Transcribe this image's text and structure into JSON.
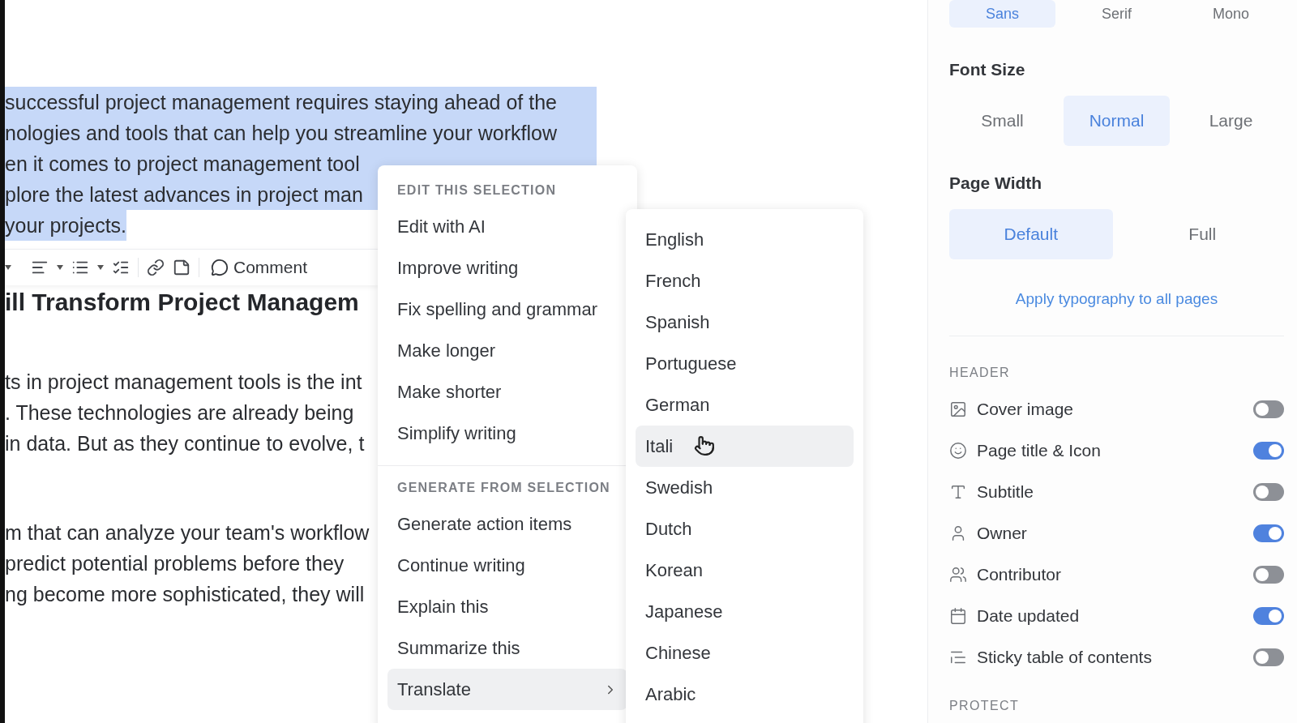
{
  "editor": {
    "selection": {
      "selected": true,
      "lines": [
        "successful project management requires staying ahead of the",
        "nologies and tools that can help you streamline your workflow",
        "en it comes to project management tool",
        "plore the latest advances in project man",
        "your projects."
      ]
    },
    "toolbar": {
      "comment_label": "Comment"
    },
    "heading": "ill Transform Project Managem",
    "paragraphs": [
      [
        "ts in project management tools is the int",
        ". These technologies are already being",
        "in data. But as they continue to evolve, t"
      ],
      [
        "m that can analyze your team's workflow",
        "predict potential problems before they",
        "ng become more sophisticated, they will"
      ]
    ]
  },
  "menu": {
    "sections": [
      {
        "title": "EDIT THIS SELECTION",
        "items": [
          {
            "label": "Edit with AI",
            "selected": false
          },
          {
            "label": "Improve writing",
            "selected": false
          },
          {
            "label": "Fix spelling and grammar",
            "selected": false
          },
          {
            "label": "Make longer",
            "selected": false
          },
          {
            "label": "Make shorter",
            "selected": false
          },
          {
            "label": "Simplify writing",
            "selected": false
          }
        ]
      },
      {
        "title": "GENERATE FROM SELECTION",
        "items": [
          {
            "label": "Generate action items",
            "selected": false
          },
          {
            "label": "Continue writing",
            "selected": false
          },
          {
            "label": "Explain this",
            "selected": false
          },
          {
            "label": "Summarize this",
            "selected": false
          },
          {
            "label": "Translate",
            "selected": true,
            "submenu": true
          }
        ]
      }
    ]
  },
  "submenu": {
    "items": [
      {
        "label": "English",
        "selected": false
      },
      {
        "label": "French",
        "selected": false
      },
      {
        "label": "Spanish",
        "selected": false
      },
      {
        "label": "Portuguese",
        "selected": false
      },
      {
        "label": "German",
        "selected": false
      },
      {
        "label": "Itali",
        "selected": true
      },
      {
        "label": "Swedish",
        "selected": false
      },
      {
        "label": "Dutch",
        "selected": false
      },
      {
        "label": "Korean",
        "selected": false
      },
      {
        "label": "Japanese",
        "selected": false
      },
      {
        "label": "Chinese",
        "selected": false
      },
      {
        "label": "Arabic",
        "selected": false
      }
    ]
  },
  "panel": {
    "font_options": [
      {
        "label": "Sans",
        "selected": true
      },
      {
        "label": "Serif",
        "selected": false
      },
      {
        "label": "Mono",
        "selected": false
      }
    ],
    "font_size": {
      "title": "Font Size",
      "options": [
        {
          "label": "Small",
          "selected": false
        },
        {
          "label": "Normal",
          "selected": true
        },
        {
          "label": "Large",
          "selected": false
        }
      ]
    },
    "page_width": {
      "title": "Page Width",
      "options": [
        {
          "label": "Default",
          "selected": true
        },
        {
          "label": "Full",
          "selected": false
        }
      ]
    },
    "apply_link": "Apply typography to all pages",
    "header": {
      "title": "HEADER",
      "items": [
        {
          "kind": "image",
          "label": "Cover image",
          "on": false
        },
        {
          "kind": "smile",
          "label": "Page title & Icon",
          "on": true
        },
        {
          "kind": "type",
          "label": "Subtitle",
          "on": false
        },
        {
          "kind": "user",
          "label": "Owner",
          "on": true
        },
        {
          "kind": "users",
          "label": "Contributor",
          "on": false
        },
        {
          "kind": "calendar",
          "label": "Date updated",
          "on": true
        },
        {
          "kind": "list",
          "label": "Sticky table of contents",
          "on": false
        }
      ]
    },
    "next_section": "PROTECT"
  }
}
